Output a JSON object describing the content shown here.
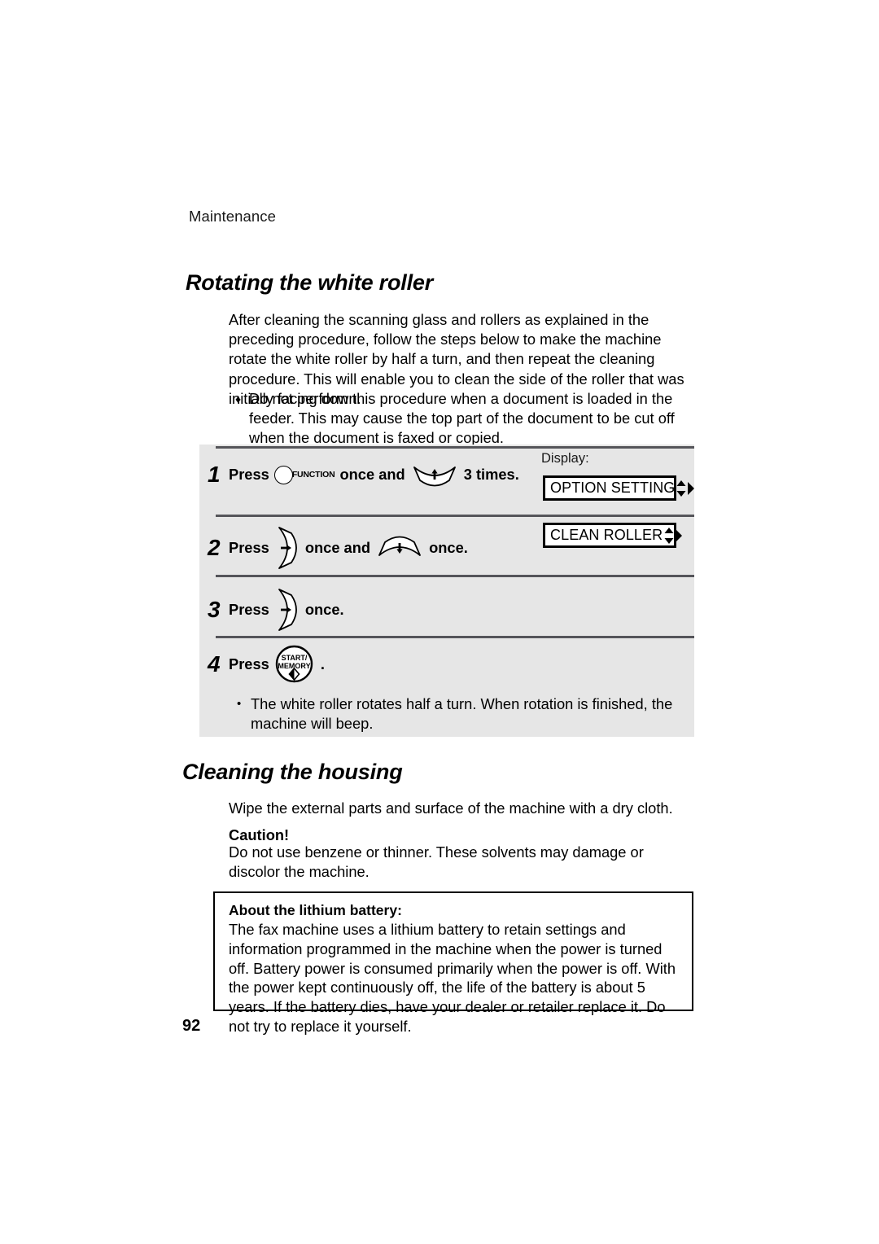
{
  "page": {
    "running_head": "Maintenance",
    "page_number": "92"
  },
  "sections": [
    {
      "heading": "Rotating the white roller",
      "intro": "After cleaning the scanning glass and rollers as explained in the preceding procedure, follow the steps below to make the machine rotate the white roller by half a turn, and then repeat the cleaning procedure. This will enable you to clean the side of the roller that was initially facing down.",
      "note_bullet": "♦",
      "note": "Do not perform this procedure when a document is loaded in the feeder. This may cause the top part of the document to be cut off when the document is faxed or copied."
    },
    {
      "heading": "Cleaning the housing",
      "wipe": "Wipe the external parts and surface of the machine with a dry cloth.",
      "caution_label": "Caution!",
      "caution": "Do not use benzene or thinner. These solvents may damage or discolor the machine."
    }
  ],
  "procedure": {
    "display_label": "Display:",
    "steps": [
      {
        "number": "1",
        "press_label": "Press",
        "key_1": "function-key",
        "key_1_label": "FUNCTION",
        "middle_label": "once and",
        "key_2": "arrow-down-key",
        "tail_label": "3 times."
      },
      {
        "number": "2",
        "press_label": "Press",
        "key_1": "arrow-right-key",
        "middle_label": "once and",
        "key_2": "arrow-up-key",
        "tail_label": "once."
      },
      {
        "number": "3",
        "press_label": "Press",
        "key_1": "arrow-right-key",
        "tail_label": "once."
      },
      {
        "number": "4",
        "press_label": "Press",
        "key_1": "start-memory-key",
        "key_1_label_line1": "START/",
        "key_1_label_line2": "MEMORY",
        "tail_label": "."
      }
    ],
    "displays": [
      {
        "text": "OPTION SETTING",
        "indicators": "up-down-right-arrows"
      },
      {
        "text": "CLEAN ROLLER",
        "indicators": "up-down-right-arrows"
      }
    ],
    "result_bullet": "•",
    "result": "The white roller rotates half a turn. When rotation is finished, the machine will beep."
  },
  "battery_note": {
    "title": "About the lithium battery:",
    "body": " The fax machine uses a lithium battery to retain settings and information programmed in the machine when the power is turned off. Battery power is consumed primarily when the power is off. With the power kept continuously off, the life of the battery is about 5 years. If the battery dies, have your dealer or retailer replace it. Do not try to replace it yourself."
  },
  "colors": {
    "panel_background": "#e6e6e6",
    "rule": "#55555a",
    "text": "#000000",
    "page_background": "#ffffff"
  }
}
